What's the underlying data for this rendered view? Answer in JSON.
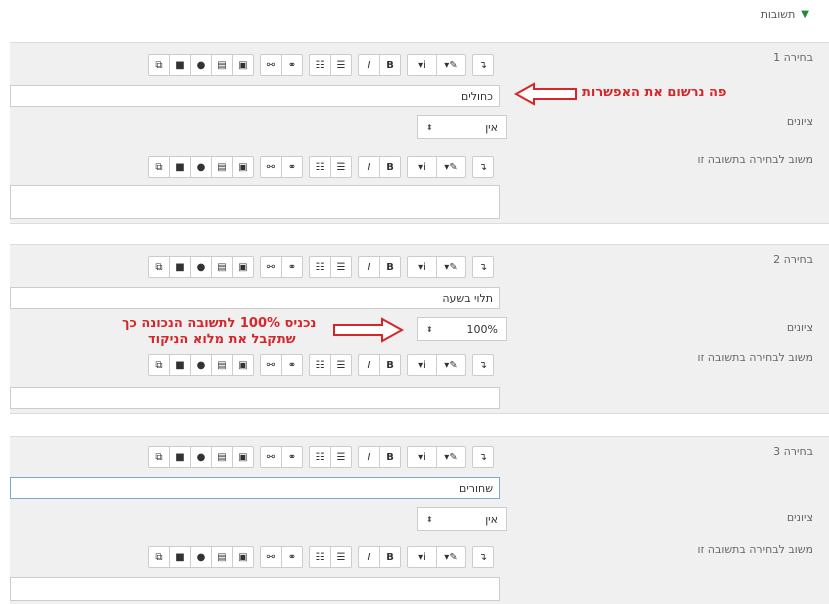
{
  "section": {
    "title": "תשובות"
  },
  "toolbar": [
    "↴",
    "✎",
    "i",
    "B",
    "I",
    "☰",
    "☷",
    "🔗",
    "⛓",
    "▣",
    "▤",
    "●",
    "■",
    "⧉"
  ],
  "choices": [
    {
      "title": "בחירה 1",
      "answer": "כחולים",
      "grades_label": "ציונים",
      "grade": "אין",
      "feedback_label": "משוב לבחירה בתשובה זו"
    },
    {
      "title": "בחירה 2",
      "answer": "תלוי בשעה",
      "grades_label": "ציונים",
      "grade": "100%",
      "feedback_label": "משוב לבחירה בתשובה זו"
    },
    {
      "title": "בחירה 3",
      "answer": "שחורים",
      "grades_label": "ציונים",
      "grade": "אין",
      "feedback_label": "משוב לבחירה בתשובה זו"
    }
  ],
  "annotations": {
    "a1": "פה נרשום את האפשרות",
    "a2_line1": "נכניס 100% לתשובה הנכונה כך",
    "a2_line2": "שתקבל את מלוא הניקוד"
  },
  "colors": {
    "annotation": "#d7262a",
    "panel": "#f0f0f0",
    "caret": "#1f8a3b"
  }
}
